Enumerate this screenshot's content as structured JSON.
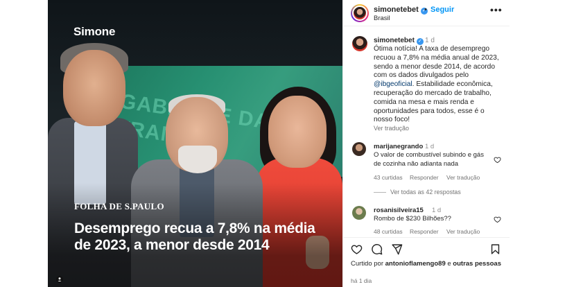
{
  "image": {
    "brand": "Simone",
    "news_source": "FOLHA DE S.PAULO",
    "headline": "Desemprego recua a 7,8% na média de 2023, a menor desde 2014",
    "background_sign_text": "GABINETE DA TRANSI"
  },
  "header": {
    "username": "simonetebet",
    "dot": "•",
    "follow_label": "Seguir",
    "location": "Brasil",
    "more_label": "•••"
  },
  "caption": {
    "username": "simonetebet",
    "time": "1 d",
    "text_before_mention": "Ótima notícia! A taxa de desemprego recuou a 7,8% na média anual de 2023, sendo a menor desde 2014, de acordo com os dados divulgados pelo ",
    "mention": "@ibgeoficial",
    "text_after_mention": ". Estabilidade econômica, recuperação do mercado de trabalho, comida na mesa e mais renda e oportunidades para todos, esse é o nosso foco!",
    "translate_label": "Ver tradução"
  },
  "comments": [
    {
      "username": "marijanegrando",
      "time": "1 d",
      "text": "O valor de combustível subindo e gás de cozinha não adianta nada",
      "likes": "43 curtidas",
      "reply_label": "Responder",
      "translate_label": "Ver tradução"
    },
    {
      "username": "rosanisilveira15",
      "time": "1 d",
      "text": "Rombo de $230 Bilhões??",
      "likes": "48 curtidas",
      "reply_label": "Responder",
      "translate_label": "Ver tradução"
    }
  ],
  "view_replies_label": "Ver todas as 42 respostas",
  "liked_by": {
    "prefix": "Curtido por ",
    "user": "antonioflamengo89",
    "middle": " e ",
    "others": "outras pessoas"
  },
  "post_age": "há 1 dia",
  "colors": {
    "follow_blue": "#0095f6",
    "verified_blue": "#3897f0",
    "mention_blue": "#00376b",
    "muted_gray": "#737373"
  },
  "icons": [
    "heart-icon",
    "comment-icon",
    "share-icon",
    "save-icon",
    "more-icon",
    "verified-icon",
    "user-tag-icon"
  ]
}
